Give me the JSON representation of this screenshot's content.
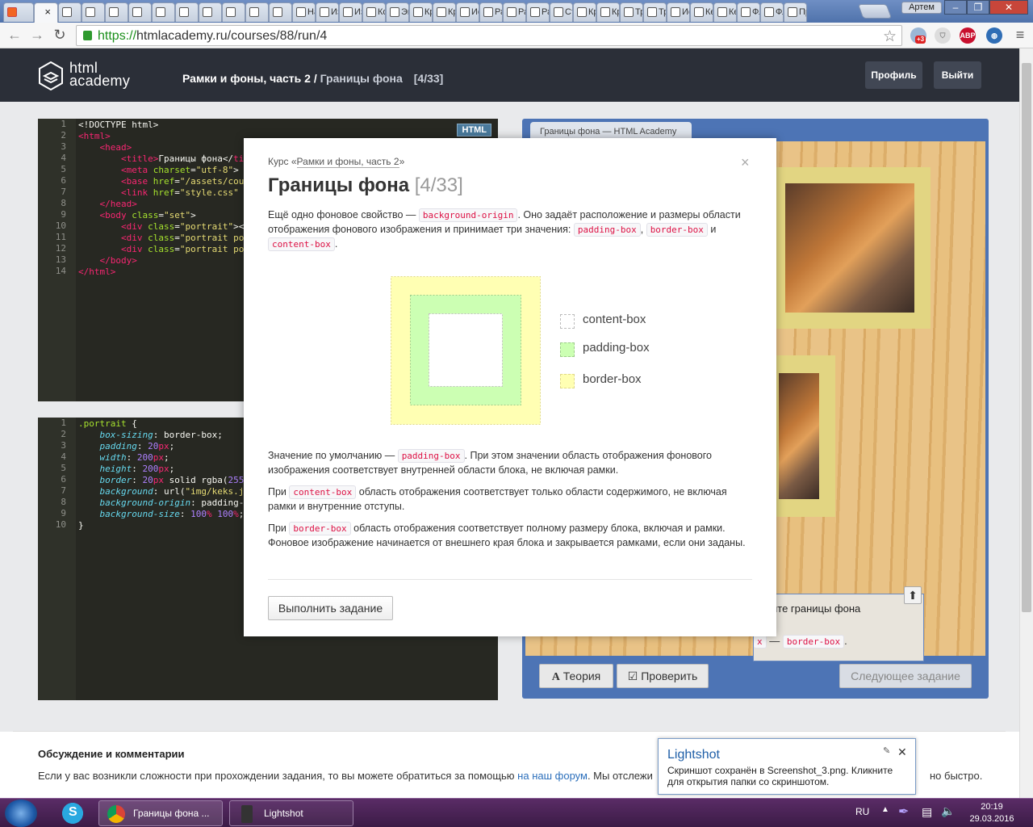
{
  "browser": {
    "tab_labels": [
      "На",
      "Из",
      "Из",
      "Ко",
      "Эк",
      "Кр",
      "Кр",
      "Ис",
      "Ра",
      "Ра",
      "Ра",
      "Ст",
      "Кр",
      "Кр",
      "Тр",
      "Тр",
      "Ис",
      "Ке",
      "Ке",
      "Фл",
      "Фл",
      "Пр"
    ],
    "profile_name": "Артем",
    "url_scheme": "https://",
    "url_rest": "htmlacademy.ru/courses/88/run/4",
    "ext_badge": "+3",
    "abp_label": "ABP"
  },
  "site": {
    "logo_line1": "html",
    "logo_line2": "academy",
    "breadcrumb_course": "Рамки и фоны, часть 2",
    "breadcrumb_sep": " / ",
    "breadcrumb_task": "Границы фона",
    "breadcrumb_count": "[4/33]",
    "profile_button": "Профиль",
    "logout_button": "Выйти"
  },
  "html_editor": {
    "badge": "HTML",
    "line_numbers": [
      "1",
      "2",
      "3",
      "4",
      "5",
      "6",
      "7",
      "8",
      "9",
      "10",
      "11",
      "12",
      "13",
      "14"
    ]
  },
  "css_editor": {
    "line_numbers": [
      "1",
      "2",
      "3",
      "4",
      "5",
      "6",
      "7",
      "8",
      "9",
      "10"
    ]
  },
  "preview": {
    "tab_title": "Границы фона — HTML Academy",
    "task_text": "йте границы фона",
    "task_chip1": "x",
    "task_dash": "—",
    "task_chip2": "border-box",
    "task_end": ".",
    "theory_button": "Теория",
    "check_button": "Проверить",
    "next_button": "Следующее задание"
  },
  "modal": {
    "course_prefix": "Курс «",
    "course_link": "Рамки и фоны, часть 2",
    "course_suffix": "»",
    "close": "×",
    "title": "Границы фона",
    "title_count": "[4/33]",
    "p1_a": "Ещё одно фоновое свойство —",
    "p1_code1": "background-origin",
    "p1_b": ". Оно задаёт расположение и размеры области отображения фонового изображения и принимает три значения:",
    "p1_code2": "padding-box",
    "p1_c": ",",
    "p1_code3": "border-box",
    "p1_d": "и",
    "p1_code4": "content-box",
    "p1_e": ".",
    "legend_content": "content-box",
    "legend_padding": "padding-box",
    "legend_border": "border-box",
    "p2_a": "Значение по умолчанию —",
    "p2_code": "padding-box",
    "p2_b": ". При этом значении область отображения фонового изображения соответствует внутренней области блока, не включая рамки.",
    "p3_a": "При",
    "p3_code": "content-box",
    "p3_b": "область отображения соответствует только области содержимого, не включая рамки и внутренние отступы.",
    "p4_a": "При",
    "p4_code": "border-box",
    "p4_b": "область отображения соответствует полному размеру блока, включая и рамки. Фоновое изображение начинается от внешнего края блока и закрывается рамками, если они заданы.",
    "do_task_button": "Выполнить задание"
  },
  "discussion": {
    "title": "Обсуждение и комментарии",
    "text_a": "Если у вас возникли сложности при прохождении задания, то вы можете обратиться за помощью",
    "link": "на наш форум",
    "text_b": ". Мы отслежи",
    "text_tail": "но быстро."
  },
  "lightshot": {
    "title": "Lightshot",
    "message": "Скриншот сохранён в Screenshot_3.png. Кликните для открытия папки со скриншотом."
  },
  "taskbar": {
    "chrome_task": "Границы фона ...",
    "lightshot_task": "Lightshot",
    "lang": "RU",
    "time": "20:19",
    "date": "29.03.2016"
  },
  "colors": {
    "header_bg": "#2b2f38",
    "preview_frame": "#4d74b5",
    "code_chip_text": "#dd1144",
    "border_box_fill": "#ffffb3",
    "padding_box_fill": "#ccffb3"
  }
}
